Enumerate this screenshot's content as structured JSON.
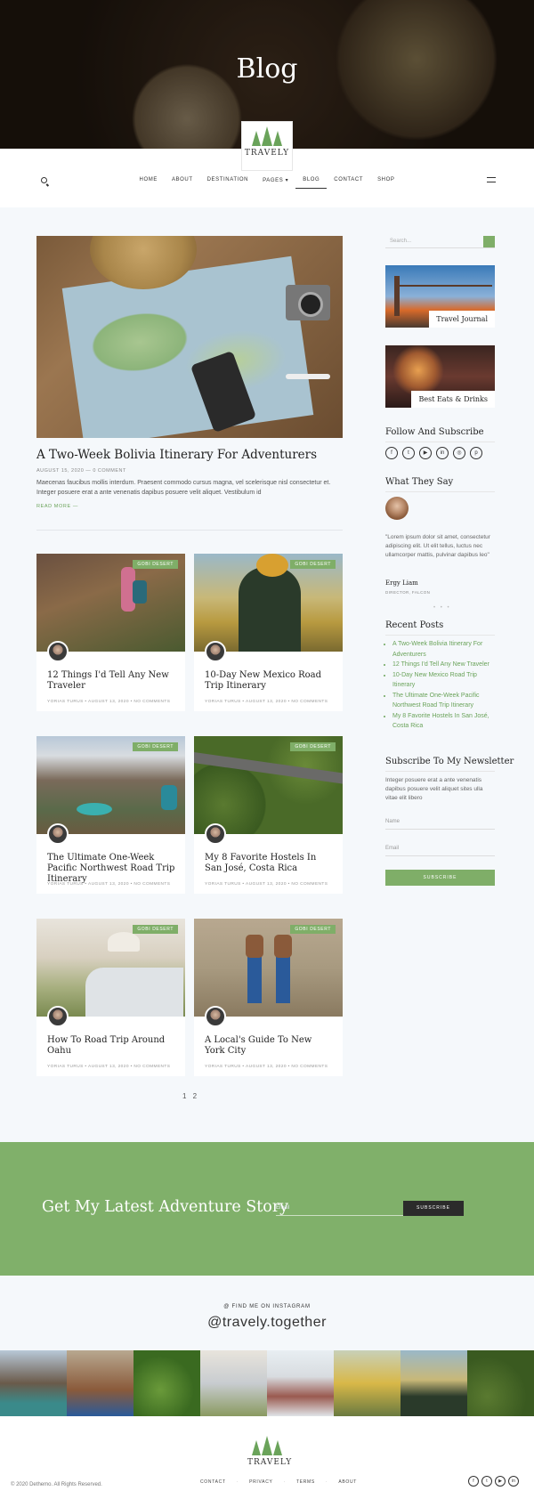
{
  "hero": {
    "title": "Blog"
  },
  "logo": {
    "text": "TRAVELY"
  },
  "nav": {
    "items": [
      "HOME",
      "ABOUT",
      "DESTINATION",
      "PAGES ▾",
      "BLOG",
      "CONTACT",
      "SHOP"
    ]
  },
  "featured": {
    "title": "A Two-Week Bolivia Itinerary For Adventurers",
    "meta": "AUGUST 15, 2020 — 0 COMMENT",
    "excerpt": "Maecenas faucibus mollis interdum. Praesent commodo cursus magna, vel scelerisque nisl consectetur et. Integer posuere erat a ante venenatis dapibus posuere velit aliquet. Vestibulum id",
    "read_more": "READ MORE —"
  },
  "posts": [
    {
      "badge": "GOBI DESERT",
      "title": "12 Things I'd Tell Any New Traveler",
      "meta": "YORIAS TURUS  •  AUGUST 13, 2020  •  NO COMMENTS"
    },
    {
      "badge": "GOBI DESERT",
      "title": "10-Day New Mexico Road Trip Itinerary",
      "meta": "YORIAS TURUS  •  AUGUST 13, 2020  •  NO COMMENTS"
    },
    {
      "badge": "GOBI DESERT",
      "title": "The Ultimate One-Week Pacific Northwest Road Trip Itinerary",
      "meta": "YORIAS TURUS  •  AUGUST 13, 2020  •  NO COMMENTS"
    },
    {
      "badge": "GOBI DESERT",
      "title": "My 8 Favorite Hostels In San José, Costa Rica",
      "meta": "YORIAS TURUS  •  AUGUST 13, 2020  •  NO COMMENTS"
    },
    {
      "badge": "GOBI DESERT",
      "title": "How To Road Trip Around Oahu",
      "meta": "YORIAS TURUS  •  AUGUST 13, 2020  •  NO COMMENTS"
    },
    {
      "badge": "GOBI DESERT",
      "title": "A Local's Guide To New York City",
      "meta": "YORIAS TURUS  •  AUGUST 13, 2020  •  NO COMMENTS"
    }
  ],
  "pagination": "1  2",
  "sidebar": {
    "search_placeholder": "Search...",
    "journal_label": "Travel Journal",
    "eats_label": "Best Eats & Drinks",
    "follow_title": "Follow And Subscribe",
    "social_icons": [
      "facebook",
      "twitter",
      "youtube",
      "linkedin",
      "instagram",
      "pinterest"
    ],
    "testimonial_title": "What They Say",
    "quote": "\"Lorem ipsum dolor sit amet, consectetur adipiscing elit. Ut elit tellus, luctus nec ullamcorper mattis, pulvinar dapibus leo\"",
    "name": "Ergy Liam",
    "role": "DIRECTOR, FALCON",
    "recent_title": "Recent Posts",
    "recent": [
      "A Two-Week Bolivia Itinerary For Adventurers",
      "12 Things I'd Tell Any New Traveler",
      "10-Day New Mexico Road Trip Itinerary",
      "The Ultimate One-Week Pacific Northwest Road Trip Itinerary",
      "My 8 Favorite Hostels In San José, Costa Rica"
    ],
    "newsletter_title": "Subscribe To My Newsletter",
    "newsletter_text": "Integer posuere erat a ante venenatis dapibus posuere velit aliquet sites ulla vitae elit libero",
    "name_placeholder": "Name",
    "email_placeholder": "Email",
    "subscribe": "SUBSCRIBE"
  },
  "band": {
    "title": "Get My Latest Adventure Story",
    "email_placeholder": "Email",
    "button": "SUBSCRIBE"
  },
  "instagram": {
    "sub": "@ FIND ME ON INSTAGRAM",
    "handle": "@travely.together"
  },
  "footer": {
    "copyright": "© 2020 Dethemo. All Rights Reserved.",
    "links": [
      "CONTACT",
      "PRIVACY",
      "TERMS",
      "ABOUT"
    ]
  },
  "colors": {
    "accent": "#80b06a",
    "dark": "#2b2b2b"
  }
}
